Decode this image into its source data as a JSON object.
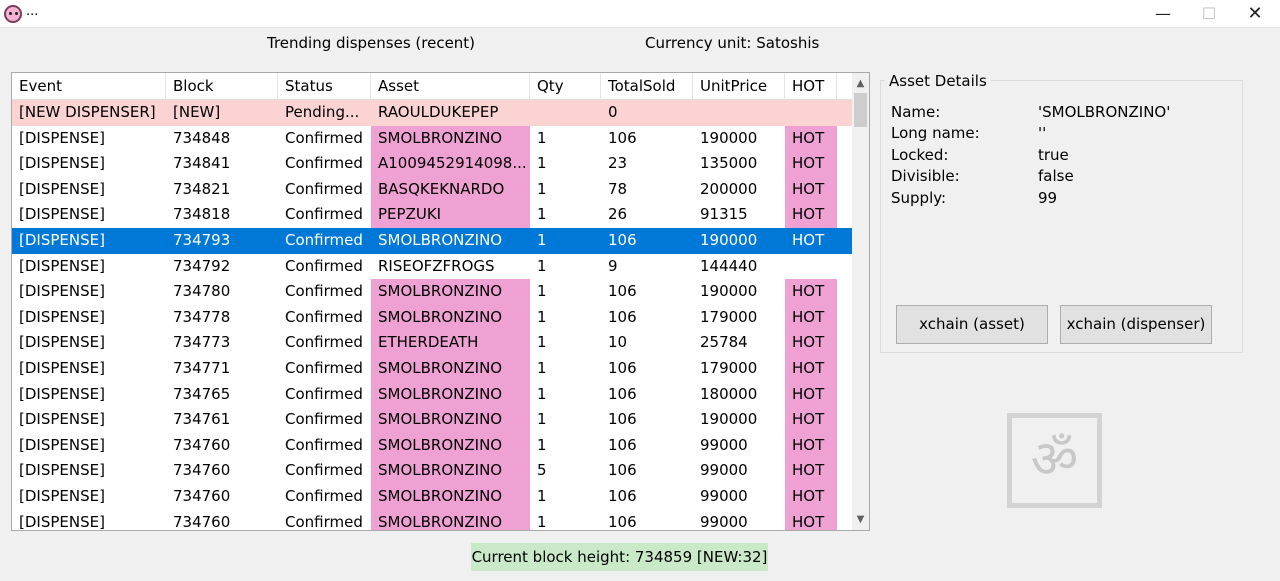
{
  "window": {
    "title": "...",
    "minimize": "—",
    "maximize": "☐",
    "close": "✕"
  },
  "header": {
    "trending_label": "Trending dispenses (recent)",
    "currency_label": "Currency unit: Satoshis"
  },
  "table": {
    "columns": [
      "Event",
      "Block",
      "Status",
      "Asset",
      "Qty",
      "TotalSold",
      "UnitPrice",
      "HOT"
    ],
    "rows": [
      {
        "event": "[NEW DISPENSER]",
        "block": "[NEW]",
        "status": "Pending...",
        "asset": "RAOULDUKEPEP",
        "qty": "",
        "total": "0",
        "price": "",
        "hot": "",
        "kind": "new"
      },
      {
        "event": "[DISPENSE]",
        "block": "734848",
        "status": "Confirmed",
        "asset": "SMOLBRONZINO",
        "qty": "1",
        "total": "106",
        "price": "190000",
        "hot": "HOT",
        "kind": "hot"
      },
      {
        "event": "[DISPENSE]",
        "block": "734841",
        "status": "Confirmed",
        "asset": "A1009452914098...",
        "qty": "1",
        "total": "23",
        "price": "135000",
        "hot": "HOT",
        "kind": "hot"
      },
      {
        "event": "[DISPENSE]",
        "block": "734821",
        "status": "Confirmed",
        "asset": "BASQKEKNARDO",
        "qty": "1",
        "total": "78",
        "price": "200000",
        "hot": "HOT",
        "kind": "hot"
      },
      {
        "event": "[DISPENSE]",
        "block": "734818",
        "status": "Confirmed",
        "asset": "PEPZUKI",
        "qty": "1",
        "total": "26",
        "price": "91315",
        "hot": "HOT",
        "kind": "hot"
      },
      {
        "event": "[DISPENSE]",
        "block": "734793",
        "status": "Confirmed",
        "asset": "SMOLBRONZINO",
        "qty": "1",
        "total": "106",
        "price": "190000",
        "hot": "HOT",
        "kind": "selected"
      },
      {
        "event": "[DISPENSE]",
        "block": "734792",
        "status": "Confirmed",
        "asset": "RISEOFZFROGS",
        "qty": "1",
        "total": "9",
        "price": "144440",
        "hot": "",
        "kind": "plain"
      },
      {
        "event": "[DISPENSE]",
        "block": "734780",
        "status": "Confirmed",
        "asset": "SMOLBRONZINO",
        "qty": "1",
        "total": "106",
        "price": "190000",
        "hot": "HOT",
        "kind": "hot"
      },
      {
        "event": "[DISPENSE]",
        "block": "734778",
        "status": "Confirmed",
        "asset": "SMOLBRONZINO",
        "qty": "1",
        "total": "106",
        "price": "179000",
        "hot": "HOT",
        "kind": "hot"
      },
      {
        "event": "[DISPENSE]",
        "block": "734773",
        "status": "Confirmed",
        "asset": "ETHERDEATH",
        "qty": "1",
        "total": "10",
        "price": "25784",
        "hot": "HOT",
        "kind": "hot"
      },
      {
        "event": "[DISPENSE]",
        "block": "734771",
        "status": "Confirmed",
        "asset": "SMOLBRONZINO",
        "qty": "1",
        "total": "106",
        "price": "179000",
        "hot": "HOT",
        "kind": "hot"
      },
      {
        "event": "[DISPENSE]",
        "block": "734765",
        "status": "Confirmed",
        "asset": "SMOLBRONZINO",
        "qty": "1",
        "total": "106",
        "price": "180000",
        "hot": "HOT",
        "kind": "hot"
      },
      {
        "event": "[DISPENSE]",
        "block": "734761",
        "status": "Confirmed",
        "asset": "SMOLBRONZINO",
        "qty": "1",
        "total": "106",
        "price": "190000",
        "hot": "HOT",
        "kind": "hot"
      },
      {
        "event": "[DISPENSE]",
        "block": "734760",
        "status": "Confirmed",
        "asset": "SMOLBRONZINO",
        "qty": "1",
        "total": "106",
        "price": "99000",
        "hot": "HOT",
        "kind": "hot"
      },
      {
        "event": "[DISPENSE]",
        "block": "734760",
        "status": "Confirmed",
        "asset": "SMOLBRONZINO",
        "qty": "5",
        "total": "106",
        "price": "99000",
        "hot": "HOT",
        "kind": "hot"
      },
      {
        "event": "[DISPENSE]",
        "block": "734760",
        "status": "Confirmed",
        "asset": "SMOLBRONZINO",
        "qty": "1",
        "total": "106",
        "price": "99000",
        "hot": "HOT",
        "kind": "hot"
      },
      {
        "event": "[DISPENSE]",
        "block": "734760",
        "status": "Confirmed",
        "asset": "SMOLBRONZINO",
        "qty": "1",
        "total": "106",
        "price": "99000",
        "hot": "HOT",
        "kind": "hot"
      }
    ]
  },
  "details": {
    "title": "Asset Details",
    "name_label": "Name:",
    "name_value": "'SMOLBRONZINO'",
    "longname_label": "Long name:",
    "longname_value": "''",
    "locked_label": "Locked:",
    "locked_value": "true",
    "divisible_label": "Divisible:",
    "divisible_value": "false",
    "supply_label": "Supply:",
    "supply_value": "99",
    "xchain_asset_button": "xchain (asset)",
    "xchain_dispenser_button": "xchain (dispenser)"
  },
  "logo": {
    "glyph": "ॐ"
  },
  "status_bar": {
    "text": "Current block height: 734859 [NEW:32]"
  },
  "colors": {
    "new_row": "#fbd3d3",
    "hot_cell": "#f0a1d3",
    "selected_row": "#0078d7",
    "status_bg": "#c9e9c9"
  }
}
